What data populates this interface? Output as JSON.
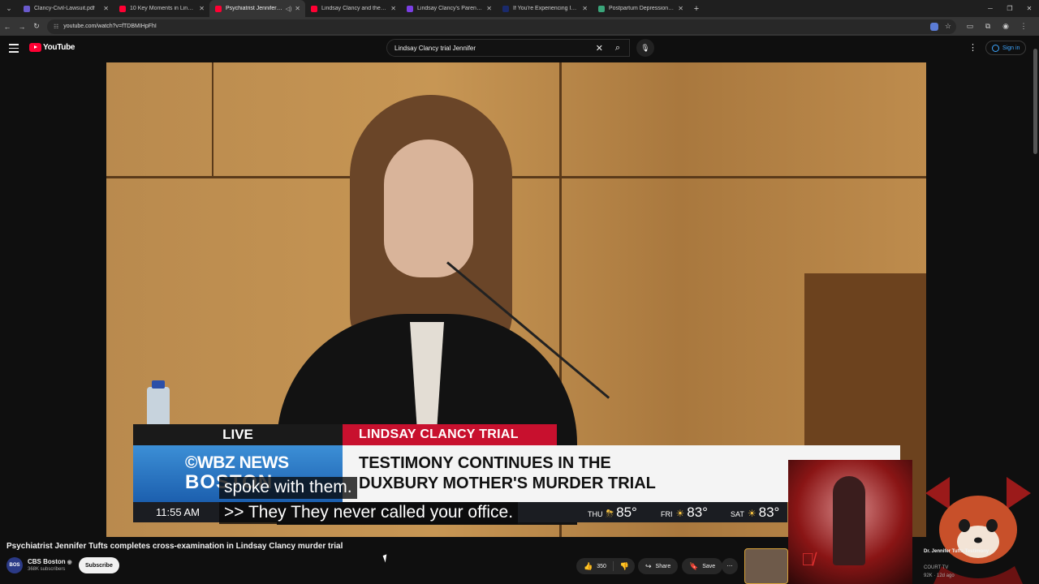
{
  "browser": {
    "tabs": [
      {
        "title": "Clancy-Civil-Lawsuit.pdf",
        "favicon_color": "#6a5acd",
        "active": false
      },
      {
        "title": "10 Key Moments in Lindsay Cl",
        "favicon_color": "#ff0033",
        "active": false
      },
      {
        "title": "Psychiatrist Jennifer Tufts c",
        "favicon_color": "#ff0033",
        "active": true,
        "audio": true
      },
      {
        "title": "Lindsay Clancy and the Eviden",
        "favicon_color": "#ff0033",
        "active": false
      },
      {
        "title": "Lindsay Clancy's Parents' $1 Mi",
        "favicon_color": "#7b3fe4",
        "active": false
      },
      {
        "title": "If You're Experiencing Intrusiv",
        "favicon_color": "#1a2a6c",
        "active": false
      },
      {
        "title": "Postpartum Depression (PPD)",
        "favicon_color": "#3aa57a",
        "active": false
      }
    ],
    "url": "youtube.com/watch?v=fTDBMIHpFhI"
  },
  "youtube": {
    "logo_text": "YouTube",
    "search_value": "Lindsay Clancy trial Jennifer",
    "sign_in": "Sign in"
  },
  "video": {
    "overlay": {
      "live": "LIVE",
      "banner": "LINDSAY CLANCY TRIAL",
      "station_line1": "©WBZ NEWS",
      "station_line2": "BOSTON",
      "headline_line1": "TESTIMONY CONTINUES IN THE",
      "headline_line2": "DUXBURY MOTHER'S MURDER TRIAL",
      "time": "11:55 AM",
      "weather": [
        {
          "day": "THU",
          "icon": "storm-sun",
          "temp": "85°"
        },
        {
          "day": "FRI",
          "icon": "sun",
          "temp": "83°"
        },
        {
          "day": "SAT",
          "icon": "sun",
          "temp": "83°"
        }
      ]
    },
    "captions": [
      "spoke with them.",
      ">> They They never called your office."
    ]
  },
  "info": {
    "title": "Psychiatrist Jennifer Tufts completes cross-examination in Lindsay Clancy murder trial",
    "channel": "CBS Boston",
    "avatar_text": "BOS",
    "subscribers": "368K subscribers",
    "subscribe": "Subscribe",
    "likes": "350",
    "share": "Share",
    "save": "Save"
  },
  "recommendation": {
    "title": "Dr. Jennifer Tufts Testimony",
    "channel": "COURT TV",
    "meta": "92K · 12d ago"
  },
  "colors": {
    "yt_red": "#ff0033",
    "trial_red": "#c8102e",
    "wbz_blue": "#1c5fae",
    "link_blue": "#3ea6ff"
  }
}
